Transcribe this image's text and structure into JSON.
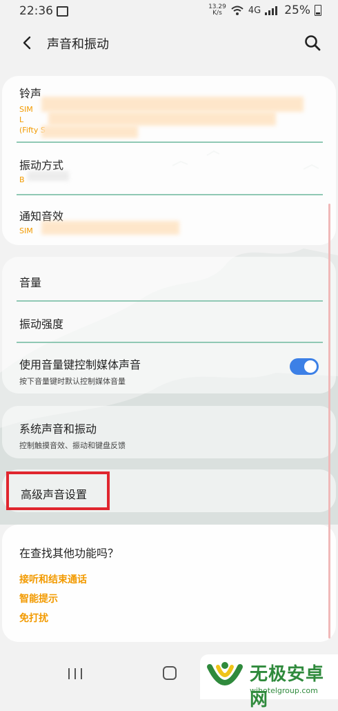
{
  "status_bar": {
    "time": "22:36",
    "net_speed_value": "13.29",
    "net_speed_unit": "K/s",
    "signal_text": "4G",
    "battery": "25%"
  },
  "header": {
    "title": "声音和振动",
    "back_icon": "back-arrow-icon",
    "search_icon": "search-icon"
  },
  "card1": {
    "ringtone": {
      "title": "铃声",
      "sub1": "SIM",
      "sub2": "L",
      "sub3": "(Fifty S"
    },
    "vibration_pattern": {
      "title": "振动方式",
      "sub": "B"
    },
    "notification_sound": {
      "title": "通知音效",
      "sub": "SIM"
    }
  },
  "card2": {
    "volume": {
      "title": "音量"
    },
    "vibration_intensity": {
      "title": "振动强度"
    },
    "media_volume_keys": {
      "title": "使用音量键控制媒体声音",
      "desc": "按下音量键时默认控制媒体音量",
      "enabled": true
    }
  },
  "card3": {
    "system_sound": {
      "title": "系统声音和振动",
      "desc": "控制触摸音效、振动和键盘反馈"
    }
  },
  "card4": {
    "advanced_sound": {
      "title": "高级声音设置"
    }
  },
  "card5": {
    "heading": "在查找其他功能吗？",
    "links": [
      "接听和结束通话",
      "智能提示",
      "免打扰"
    ]
  },
  "watermark": {
    "title": "无极安卓网",
    "url": "wjhotelgroup.com"
  },
  "colors": {
    "accent_orange": "#f29a00",
    "toggle_blue": "#3c80e6",
    "highlight_red": "#e0262e",
    "divider_green": "#8fc8b4"
  }
}
